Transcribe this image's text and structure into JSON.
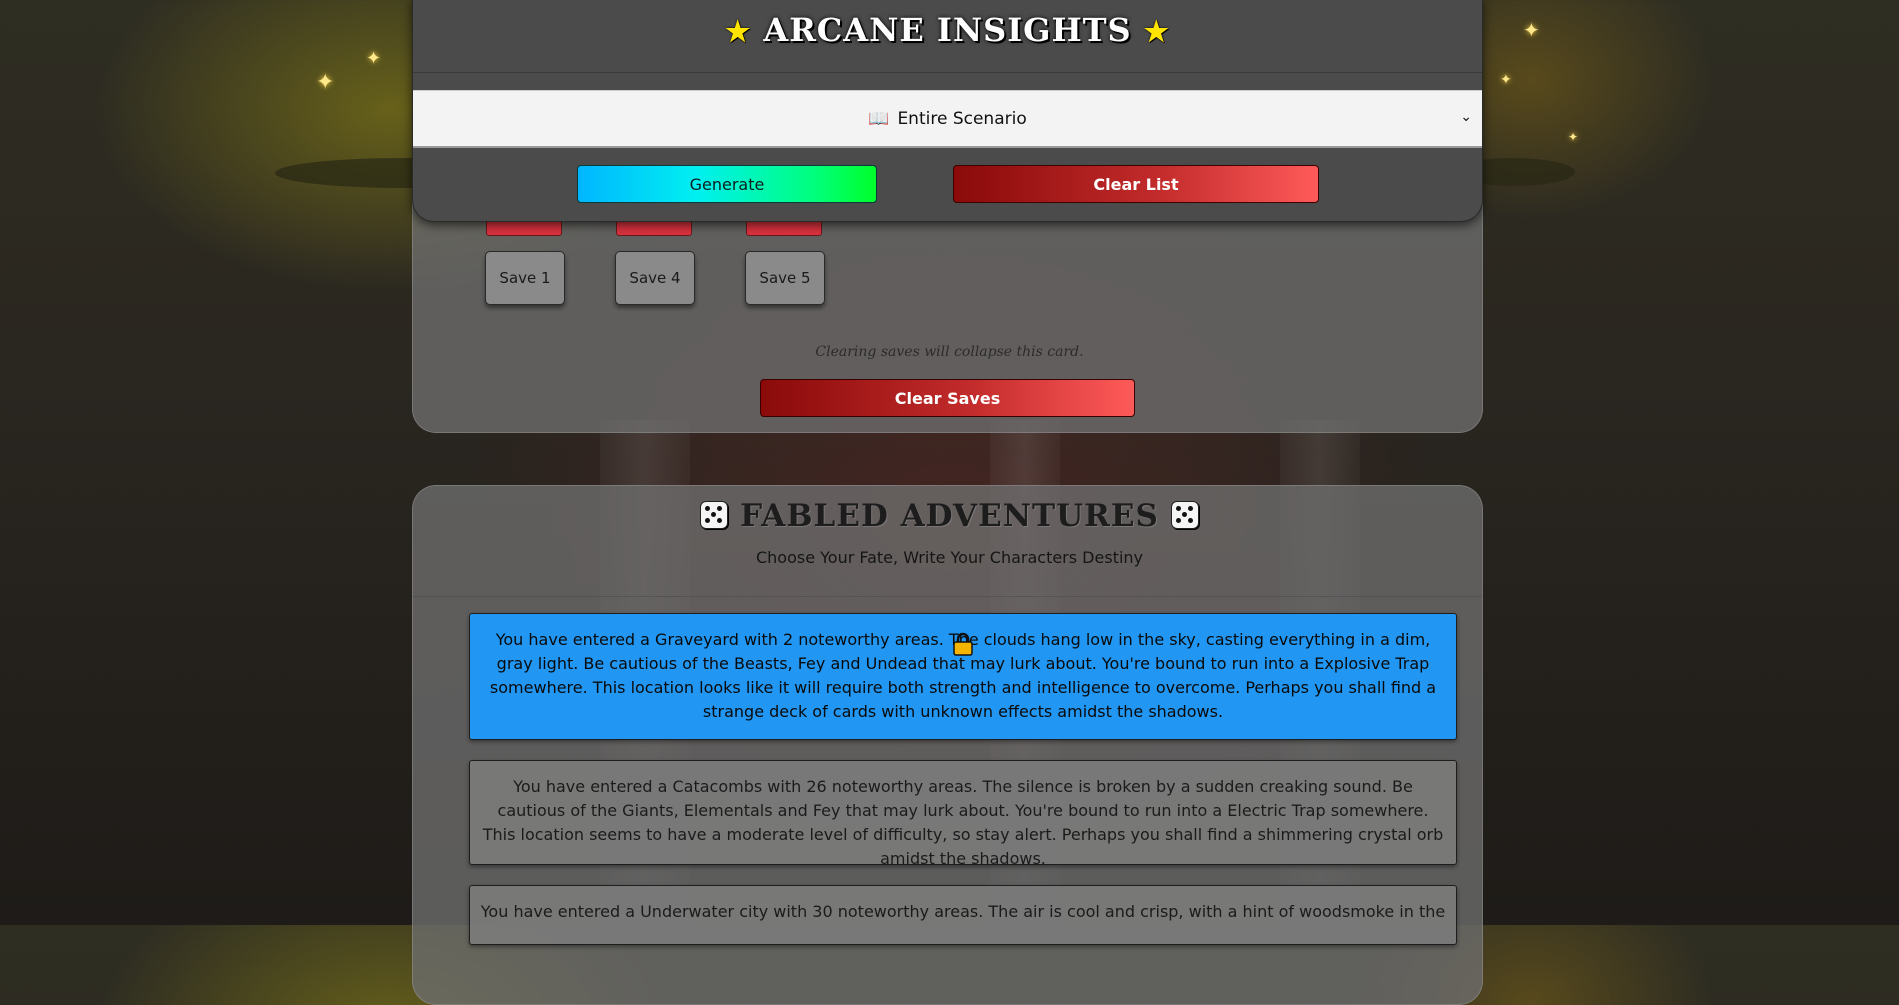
{
  "header": {
    "title": "ARCANE INSIGHTS",
    "scope_select": {
      "selected": "Entire Scenario"
    },
    "generate_label": "Generate",
    "clear_list_label": "Clear List"
  },
  "saves": {
    "buttons": [
      {
        "label": "Save 1"
      },
      {
        "label": "Save 4"
      },
      {
        "label": "Save 5"
      }
    ],
    "hint": "Clearing saves will collapse this card.",
    "clear_saves_label": "Clear Saves"
  },
  "fabled": {
    "title": "FABLED ADVENTURES",
    "subtitle": "Choose Your Fate, Write Your Characters Destiny",
    "scenarios": [
      {
        "text": "You have entered a Graveyard with 2 noteworthy areas. The clouds hang low in the sky, casting everything in a dim, gray light. Be cautious of the Beasts, Fey and Undead that may lurk about. You're bound to run into a Explosive Trap somewhere. This location looks like it will require both strength and intelligence to overcome. Perhaps you shall find a strange deck of cards with unknown effects amidst the shadows.",
        "locked": true
      },
      {
        "text": "You have entered a Catacombs with 26 noteworthy areas. The silence is broken by a sudden creaking sound. Be cautious of the Giants, Elementals and Fey that may lurk about. You're bound to run into a Electric Trap somewhere. This location seems to have a moderate level of difficulty, so stay alert. Perhaps you shall find a shimmering crystal orb amidst the shadows.",
        "locked": false
      },
      {
        "text": "You have entered a Underwater city with 30 noteworthy areas. The air is cool and crisp, with a hint of woodsmoke in the",
        "locked": false
      }
    ]
  },
  "colors": {
    "locked_card": "#2196f3",
    "generate_gradient": [
      "#00b6ff",
      "#00ff2a"
    ],
    "danger_gradient": [
      "#8a0a0a",
      "#ff5a5a"
    ],
    "star": "#ffe400"
  },
  "icons": [
    "star-icon",
    "book-icon",
    "chevron-down-icon",
    "die-icon",
    "lock-icon"
  ]
}
